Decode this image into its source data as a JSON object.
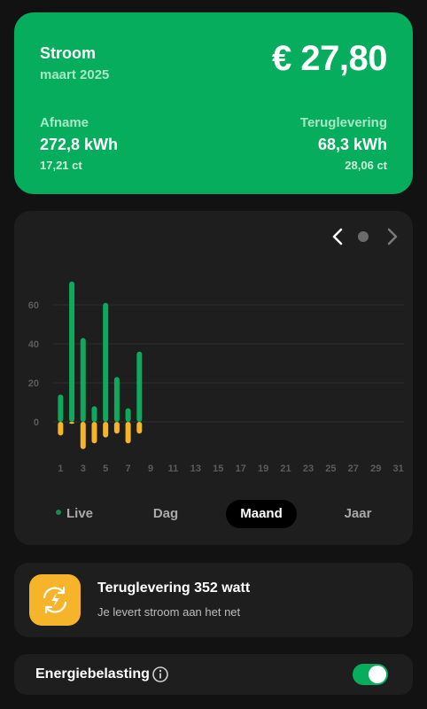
{
  "summary": {
    "title": "Stroom",
    "period": "maart 2025",
    "amount": "€ 27,80",
    "intake_label": "Afname",
    "intake_value": "272,8 kWh",
    "intake_rate": "17,21 ct",
    "return_label": "Teruglevering",
    "return_value": "68,3 kWh",
    "return_rate": "28,06 ct"
  },
  "chart_nav": {
    "prev_icon": "chevron-left-icon",
    "page_indicator": "dot",
    "next_icon": "chevron-right-icon"
  },
  "chart_data": {
    "type": "bar",
    "title": "",
    "xlabel": "",
    "ylabel": "",
    "y_ticks": [
      "60",
      "40",
      "20",
      "0"
    ],
    "x_ticks": [
      "1",
      "3",
      "5",
      "7",
      "9",
      "11",
      "13",
      "15",
      "17",
      "19",
      "21",
      "23",
      "25",
      "27",
      "29",
      "31"
    ],
    "ylim": [
      -15,
      72
    ],
    "grid": true,
    "categories": [
      1,
      2,
      3,
      4,
      5,
      6,
      7,
      8
    ],
    "series": [
      {
        "values": [
          14,
          72,
          43,
          8,
          61,
          23,
          7,
          36
        ],
        "color": "#0fa85c"
      },
      {
        "values": [
          -7,
          -1,
          -14,
          -11,
          -8,
          -6,
          -11,
          -6
        ],
        "color": "#f5b42a"
      }
    ]
  },
  "periods": {
    "live": "Live",
    "day": "Dag",
    "month": "Maand",
    "year": "Jaar",
    "active": "Maand"
  },
  "feed": {
    "title": "Teruglevering 352 watt",
    "subtitle": "Je levert stroom aan het net",
    "icon": "solar-return-icon"
  },
  "tax": {
    "label": "Energiebelasting",
    "info_icon": "info-icon",
    "enabled": true
  },
  "colors": {
    "accent": "#06ad5d",
    "return": "#f5b42a",
    "card": "#1e1e1e",
    "background": "#121212"
  }
}
